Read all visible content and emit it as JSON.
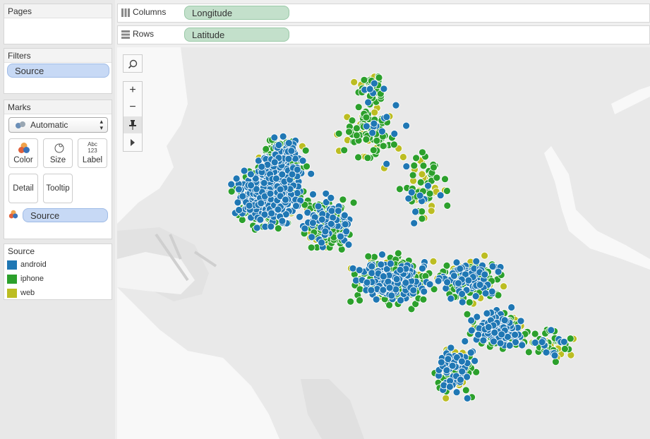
{
  "pages": {
    "title": "Pages"
  },
  "filters": {
    "title": "Filters",
    "pill": "Source"
  },
  "marks": {
    "title": "Marks",
    "type": "Automatic",
    "buttons": {
      "color": "Color",
      "size": "Size",
      "label": "Label",
      "detail": "Detail",
      "tooltip": "Tooltip",
      "label_icon_top": "Abc",
      "label_icon_bottom": "123"
    },
    "color_pill": "Source"
  },
  "legend": {
    "title": "Source",
    "items": [
      {
        "label": "android",
        "color": "#1f77b4"
      },
      {
        "label": "iphone",
        "color": "#2ca02c"
      },
      {
        "label": "web",
        "color": "#bcbd22"
      }
    ]
  },
  "shelves": {
    "columns": {
      "label": "Columns",
      "pill": "Longitude"
    },
    "rows": {
      "label": "Rows",
      "pill": "Latitude"
    }
  },
  "map": {
    "colors": {
      "android": "#1f77b4",
      "iphone": "#2ca02c",
      "web": "#bcbd22",
      "water": "#f8f8f8",
      "land": "#e9e9e9"
    },
    "tools": [
      "search-icon",
      "zoom-in-icon",
      "zoom-out-icon",
      "pin-icon",
      "expand-icon"
    ]
  }
}
